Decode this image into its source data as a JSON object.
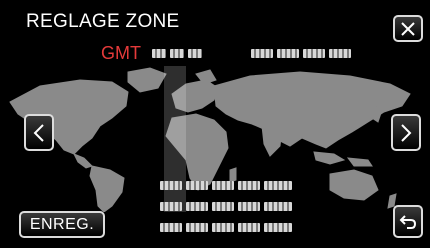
{
  "header": {
    "title": "REGLAGE ZONE"
  },
  "timezone": {
    "label": "GMT"
  },
  "buttons": {
    "close_icon": "close-icon",
    "prev_icon": "chevron-left-icon",
    "next_icon": "chevron-right-icon",
    "back_icon": "return-icon",
    "save_label": "ENREG."
  },
  "colors": {
    "accent": "#e43a3a",
    "map": "#8a8a8a",
    "background": "#000000"
  }
}
